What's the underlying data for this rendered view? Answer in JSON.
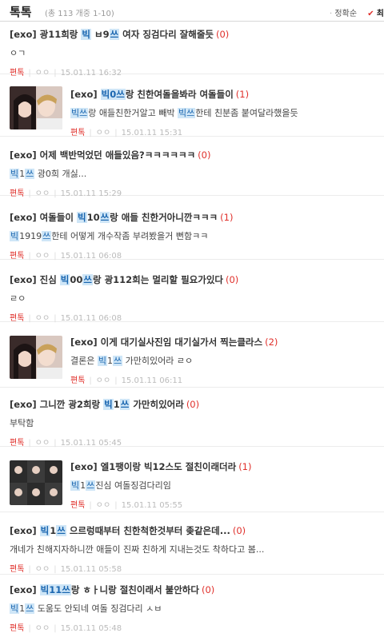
{
  "header": {
    "title": "톡톡",
    "meta": "(총 113 개중 1-10)",
    "sort_dot": "·",
    "sort_recent": "정확순",
    "sort_check": "✔",
    "sort_active": "최"
  },
  "posts": [
    {
      "t1": "[exo] 광11희랑 ",
      "h1": "빅",
      "t2": " ㅂ9",
      "h2": "쓰",
      "t3": " 여자 징검다리 잘해줄듯",
      "count": "(0)",
      "p1": "ㅇㄱ",
      "ph1": "",
      "p2": "",
      "ph2": "",
      "p3": "",
      "cat": "편톡",
      "user": "ㅇㅇ",
      "date": "15.01.11 16:32"
    },
    {
      "t1": "[exo] ",
      "h1": "빅0쓰",
      "t2": "랑 친한여돌을봐라 여돌들이",
      "h2": "",
      "t3": "",
      "count": "(1)",
      "p1": "",
      "ph1": "빅쓰",
      "p2": "랑 애들친한거알고 빼박 ",
      "ph2": "빅쓰",
      "p3": "한테 친분좀 붙여달라했을듯",
      "cat": "편톡",
      "user": "ㅇㅇ",
      "date": "15.01.11 15:31"
    },
    {
      "t1": "[exo] 어제 백반먹었던 애들있음?ㅋㅋㅋㅋㅋㅋ",
      "h1": "",
      "t2": "",
      "h2": "",
      "t3": "",
      "count": "(0)",
      "p1": "",
      "ph1": "빅",
      "p2": "1",
      "ph2": "쓰",
      "p3": " 광0희 개싫...",
      "cat": "편톡",
      "user": "ㅇㅇ",
      "date": "15.01.11 15:29"
    },
    {
      "t1": "[exo] 여돌들이 ",
      "h1": "빅",
      "t2": "10",
      "h2": "쓰",
      "t3": "랑 애들 친한거아니깐ㅋㅋㅋ",
      "count": "(1)",
      "p1": "",
      "ph1": "빅",
      "p2": "1919",
      "ph2": "쓰",
      "p3": "한테 어떻게 개수작좀 부려봤을거 뻔함ㅋㅋ",
      "cat": "편톡",
      "user": "ㅇㅇ",
      "date": "15.01.11 06:08"
    },
    {
      "t1": "[exo] 진심 ",
      "h1": "빅",
      "t2": "00",
      "h2": "쓰",
      "t3": "랑 광112희는 멀리할 필요가있다",
      "count": "(0)",
      "p1": "ㄹㅇ",
      "ph1": "",
      "p2": "",
      "ph2": "",
      "p3": "",
      "cat": "편톡",
      "user": "ㅇㅇ",
      "date": "15.01.11 06:08"
    },
    {
      "t1": "[exo] 이게 대기실사진임 대기실가서 찍는클라스",
      "h1": "",
      "t2": "",
      "h2": "",
      "t3": "",
      "count": "(2)",
      "p1": "결론은 ",
      "ph1": "빅",
      "p2": "1",
      "ph2": "쓰",
      "p3": " 가만히있어라 ㄹㅇ",
      "cat": "편톡",
      "user": "ㅇㅇ",
      "date": "15.01.11 06:11"
    },
    {
      "t1": "[exo] 그니깐 광2희랑 ",
      "h1": "빅",
      "t2": "1",
      "h2": "쓰",
      "t3": " 가만히있어라",
      "count": "(0)",
      "p1": "부탁함",
      "ph1": "",
      "p2": "",
      "ph2": "",
      "p3": "",
      "cat": "편톡",
      "user": "ㅇㅇ",
      "date": "15.01.11 05:45"
    },
    {
      "t1": "[exo] 엘1팽이랑 빅12스도 절친이래더라",
      "h1": "",
      "t2": "",
      "h2": "",
      "t3": "",
      "count": "(1)",
      "p1": "",
      "ph1": "빅",
      "p2": "1",
      "ph2": "쓰",
      "p3": "진심 여돌징검다리임",
      "cat": "편톡",
      "user": "ㅇㅇ",
      "date": "15.01.11 05:55"
    },
    {
      "t1": "[exo] ",
      "h1": "빅",
      "t2": "1",
      "h2": "쓰",
      "t3": " 으르렁때부터 친한척한것부터 좆같은데...",
      "count": "(0)",
      "p1": "개네가 친해지자하니깐 애들이 진짜 친하게 지내는것도 착하다고 봄...",
      "ph1": "",
      "p2": "",
      "ph2": "",
      "p3": "",
      "cat": "편톡",
      "user": "ㅇㅇ",
      "date": "15.01.11 05:58"
    },
    {
      "t1": "[exo] ",
      "h1": "빅11쓰",
      "t2": "랑 ㅎㅏ니랑 절친이래서 불안하다",
      "h2": "",
      "t3": "",
      "count": "(0)",
      "p1": "",
      "ph1": "빅",
      "p2": "1",
      "ph2": "쓰",
      "p3": " 도움도 안되네 여돌 징검다리 ㅅㅂ",
      "cat": "편톡",
      "user": "ㅇㅇ",
      "date": "15.01.11 05:48"
    }
  ]
}
